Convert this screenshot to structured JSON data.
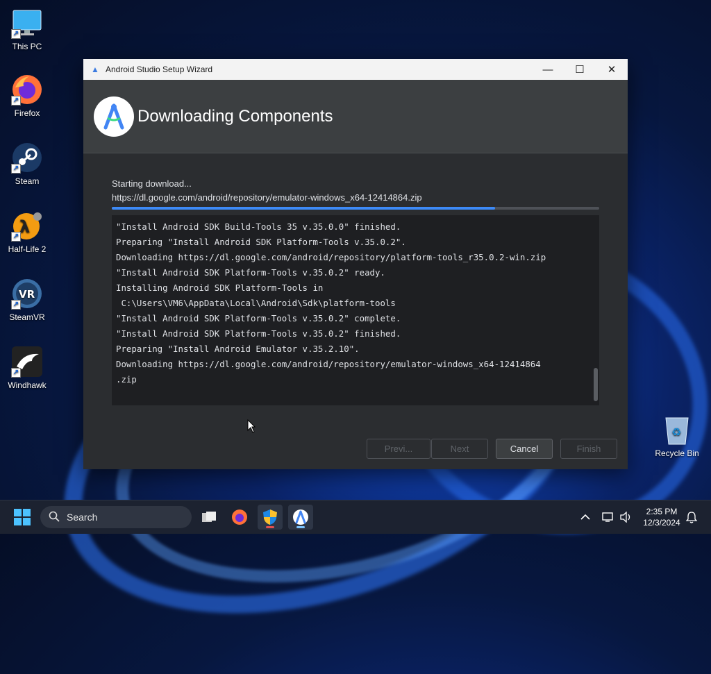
{
  "desktop": {
    "icons": [
      {
        "label": "This PC"
      },
      {
        "label": "Firefox"
      },
      {
        "label": "Steam"
      },
      {
        "label": "Half-Life 2"
      },
      {
        "label": "SteamVR"
      },
      {
        "label": "Windhawk"
      },
      {
        "label": "Recycle Bin"
      }
    ]
  },
  "window": {
    "title": "Android Studio Setup Wizard",
    "minimize": "—",
    "maximize": "☐",
    "close": "✕"
  },
  "wizard": {
    "header_title": "Downloading Components",
    "status": "Starting download...",
    "url": "https://dl.google.com/android/repository/emulator-windows_x64-12414864.zip",
    "progress_fraction": 0.786,
    "log_lines": [
      "\"Install Android SDK Build-Tools 35 v.35.0.0\" finished.",
      "Preparing \"Install Android SDK Platform-Tools v.35.0.2\".",
      "Downloading https://dl.google.com/android/repository/platform-tools_r35.0.2-win.zip",
      "\"Install Android SDK Platform-Tools v.35.0.2\" ready.",
      "Installing Android SDK Platform-Tools in",
      " C:\\Users\\VM6\\AppData\\Local\\Android\\Sdk\\platform-tools",
      "\"Install Android SDK Platform-Tools v.35.0.2\" complete.",
      "\"Install Android SDK Platform-Tools v.35.0.2\" finished.",
      "Preparing \"Install Android Emulator v.35.2.10\".",
      "Downloading https://dl.google.com/android/repository/emulator-windows_x64-12414864",
      ".zip"
    ],
    "buttons": {
      "previous": "Previ...",
      "next": "Next",
      "cancel": "Cancel",
      "finish": "Finish"
    }
  },
  "taskbar": {
    "search_label": "Search",
    "time": "2:35 PM",
    "date": "12/3/2024"
  }
}
